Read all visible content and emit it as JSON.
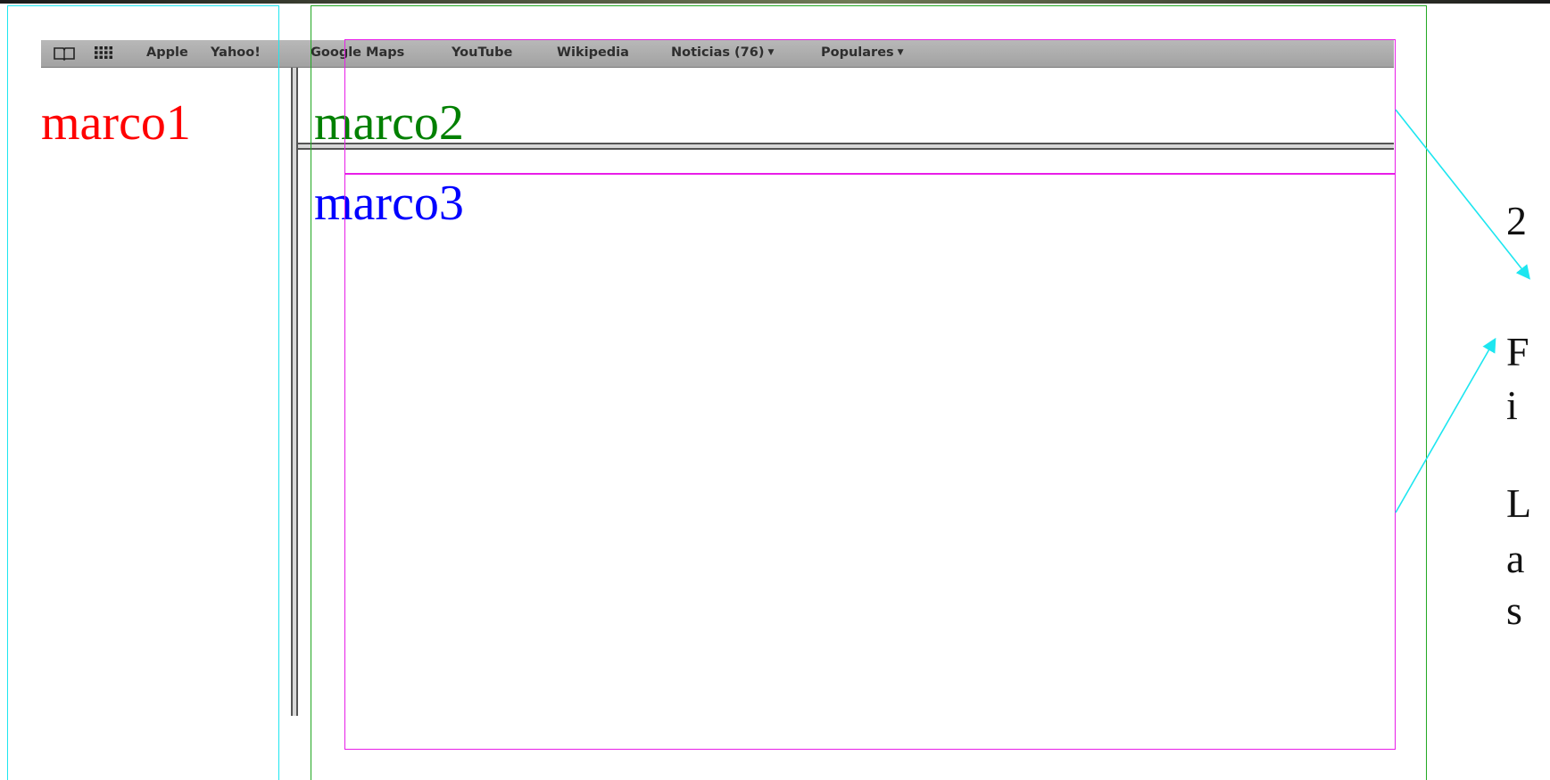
{
  "bookmarks_bar": {
    "links": [
      {
        "label": "Apple"
      },
      {
        "label": "Yahoo!"
      },
      {
        "label": "Google Maps"
      },
      {
        "label": "YouTube"
      },
      {
        "label": "Wikipedia"
      },
      {
        "label": "Noticias (76)",
        "dropdown": true
      },
      {
        "label": "Populares",
        "dropdown": true
      }
    ],
    "icons": [
      "open-book-icon",
      "grid-icon"
    ]
  },
  "frames": {
    "frame1": {
      "label": "marco1",
      "color": "#ff0000"
    },
    "frame2": {
      "label": "marco2",
      "color": "#008000"
    },
    "frame3": {
      "label": "marco3",
      "color": "#0000ff"
    }
  },
  "annotation": {
    "rows_label_chars": [
      "2",
      "F",
      "i",
      "L",
      "a",
      "s"
    ],
    "colors": {
      "cyan": "#1de6f0",
      "green": "#22a822",
      "magenta": "#e81ee8"
    }
  }
}
